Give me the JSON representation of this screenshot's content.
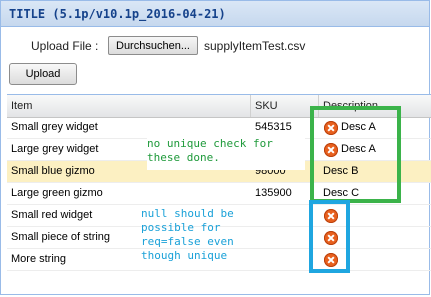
{
  "title": "TITLE (5.1p/v10.1p_2016-04-21)",
  "upload": {
    "label": "Upload File :",
    "browse_label": "Durchsuchen...",
    "filename": "supplyItemTest.csv",
    "button_label": "Upload"
  },
  "grid": {
    "columns": [
      "Item",
      "SKU",
      "Description"
    ],
    "rows": [
      {
        "item": "Small grey widget",
        "sku": "545315",
        "description": "Desc A",
        "error": true,
        "selected": false
      },
      {
        "item": "Large grey widget",
        "sku": "",
        "description": "Desc A",
        "error": true,
        "selected": false
      },
      {
        "item": "Small blue gizmo",
        "sku": "98000",
        "description": "Desc B",
        "error": false,
        "selected": true
      },
      {
        "item": "Large green gizmo",
        "sku": "135900",
        "description": "Desc C",
        "error": false,
        "selected": false
      },
      {
        "item": "Small red widget",
        "sku": "",
        "description": "",
        "error": true,
        "selected": false
      },
      {
        "item": "Small piece of string",
        "sku": "",
        "description": "",
        "error": true,
        "selected": false
      },
      {
        "item": "More string",
        "sku": "",
        "description": "",
        "error": true,
        "selected": false
      }
    ]
  },
  "annotations": {
    "green_note": "no unique check for\nthese done.",
    "blue_note": "null should be\npossible for\nreq=false even\nthough unique"
  },
  "colors": {
    "title_text": "#15428b",
    "selected_row": "#fcf0c2",
    "error_icon": "#e8601e",
    "green_annotation": "#3bb34a",
    "blue_annotation": "#1fa6e0"
  }
}
